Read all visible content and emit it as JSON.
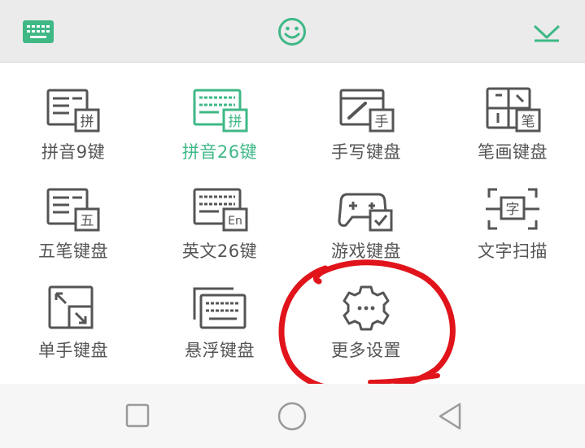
{
  "colors": {
    "accent": "#3fb886",
    "icon_stroke": "#555555",
    "annotation": "#e0141a",
    "topbar_bg": "#ebebeb"
  },
  "topbar": {
    "left_icon": "keyboard-icon",
    "center_icon": "emoji-smiley-icon",
    "right_icon": "collapse-chevron-down-icon"
  },
  "items": [
    {
      "label": "拼音9键",
      "icon": "pinyin-9-keyboard-icon",
      "badge": "拼",
      "active": false
    },
    {
      "label": "拼音26键",
      "icon": "pinyin-26-keyboard-icon",
      "badge": "拼",
      "active": true
    },
    {
      "label": "手写键盘",
      "icon": "handwriting-keyboard-icon",
      "badge": "手",
      "active": false
    },
    {
      "label": "笔画键盘",
      "icon": "stroke-keyboard-icon",
      "badge": "笔",
      "active": false
    },
    {
      "label": "五笔键盘",
      "icon": "wubi-keyboard-icon",
      "badge": "五",
      "active": false
    },
    {
      "label": "英文26键",
      "icon": "english-26-keyboard-icon",
      "badge": "En",
      "active": false
    },
    {
      "label": "游戏键盘",
      "icon": "game-keyboard-icon",
      "badge": "",
      "active": false
    },
    {
      "label": "文字扫描",
      "icon": "text-scan-icon",
      "badge": "字",
      "active": false
    },
    {
      "label": "单手键盘",
      "icon": "one-hand-keyboard-icon",
      "badge": "",
      "active": false
    },
    {
      "label": "悬浮键盘",
      "icon": "floating-keyboard-icon",
      "badge": "",
      "active": false
    },
    {
      "label": "更多设置",
      "icon": "more-settings-gear-icon",
      "badge": "",
      "active": false
    }
  ],
  "navbar": {
    "recent": "recent-apps-square-icon",
    "home": "home-circle-icon",
    "back": "back-triangle-icon"
  }
}
